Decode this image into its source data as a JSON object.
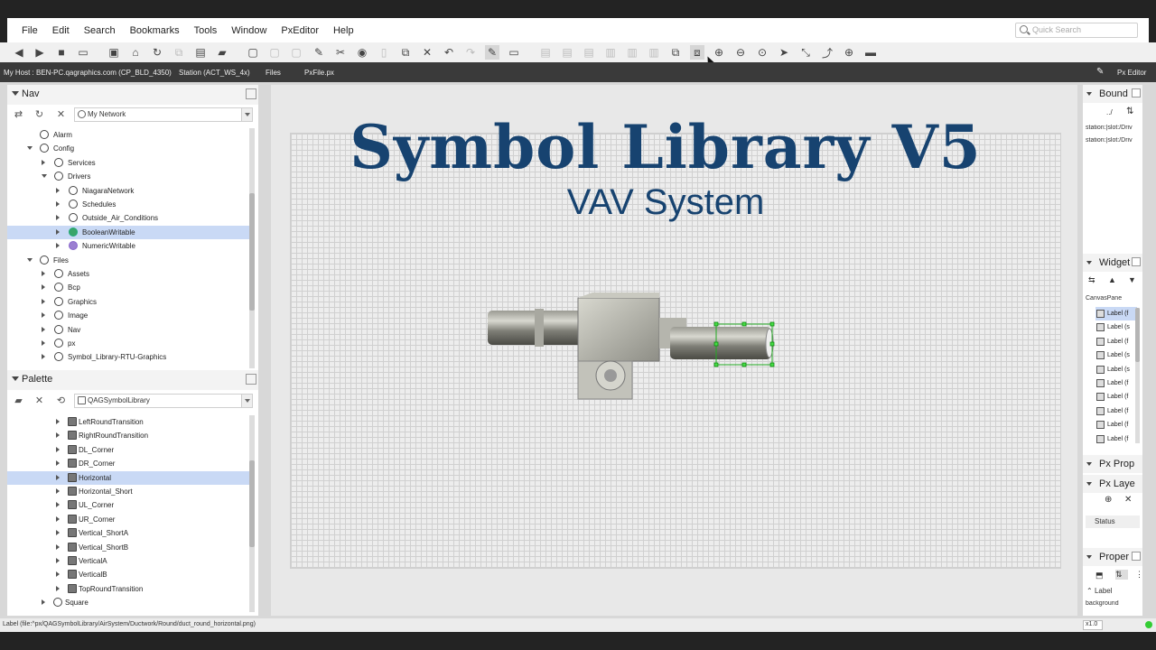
{
  "menubar": {
    "items": [
      "File",
      "Edit",
      "Search",
      "Bookmarks",
      "Tools",
      "Window",
      "PxEditor",
      "Help"
    ],
    "quick_search_placeholder": "Quick Search"
  },
  "locationbar": {
    "crumbs": [
      "My Host : BEN-PC.qagraphics.com (CP_BLD_4350)",
      "Station (ACT_WS_4x)",
      "Files",
      "PxFile.px"
    ],
    "right_label": "Px Editor"
  },
  "nav": {
    "title": "Nav",
    "dropdown": "My Network",
    "tree": [
      {
        "label": "Alarm",
        "indent": 0,
        "expander": "none",
        "icon": "alarm-icon"
      },
      {
        "label": "Config",
        "indent": 0,
        "expander": "open",
        "icon": "config-icon"
      },
      {
        "label": "Services",
        "indent": 1,
        "expander": "closed",
        "icon": "services-icon"
      },
      {
        "label": "Drivers",
        "indent": 1,
        "expander": "open",
        "icon": "drivers-icon"
      },
      {
        "label": "NiagaraNetwork",
        "indent": 2,
        "expander": "closed",
        "icon": "network-icon"
      },
      {
        "label": "Schedules",
        "indent": 2,
        "expander": "closed",
        "icon": "schedule-icon"
      },
      {
        "label": "Outside_Air_Conditions",
        "indent": 2,
        "expander": "closed",
        "icon": "folder-icon"
      },
      {
        "label": "BooleanWritable",
        "indent": 2,
        "expander": "closed",
        "icon": "boolean-icon",
        "selected": true
      },
      {
        "label": "NumericWritable",
        "indent": 2,
        "expander": "closed",
        "icon": "numeric-icon"
      },
      {
        "label": "Files",
        "indent": 0,
        "expander": "open",
        "icon": "files-icon"
      },
      {
        "label": "Assets",
        "indent": 1,
        "expander": "closed",
        "icon": "folder-icon"
      },
      {
        "label": "Bcp",
        "indent": 1,
        "expander": "closed",
        "icon": "folder-icon"
      },
      {
        "label": "Graphics",
        "indent": 1,
        "expander": "closed",
        "icon": "folder-icon"
      },
      {
        "label": "Image",
        "indent": 1,
        "expander": "closed",
        "icon": "folder-icon"
      },
      {
        "label": "Nav",
        "indent": 1,
        "expander": "closed",
        "icon": "folder-icon"
      },
      {
        "label": "px",
        "indent": 1,
        "expander": "closed",
        "icon": "folder-icon"
      },
      {
        "label": "Symbol_Library-RTU-Graphics",
        "indent": 1,
        "expander": "closed",
        "icon": "folder-icon"
      }
    ]
  },
  "palette": {
    "title": "Palette",
    "dropdown": "QAGSymbolLibrary",
    "items": [
      {
        "label": "LeftRoundTransition"
      },
      {
        "label": "RightRoundTransition"
      },
      {
        "label": "DL_Corner"
      },
      {
        "label": "DR_Corner"
      },
      {
        "label": "Horizontal",
        "selected": true
      },
      {
        "label": "Horizontal_Short"
      },
      {
        "label": "UL_Corner"
      },
      {
        "label": "UR_Corner"
      },
      {
        "label": "Vertical_ShortA"
      },
      {
        "label": "Vertical_ShortB"
      },
      {
        "label": "VerticalA"
      },
      {
        "label": "VerticalB"
      },
      {
        "label": "TopRoundTransition"
      }
    ],
    "footer_item": "Square"
  },
  "canvas": {
    "title": "Symbol Library V5",
    "subtitle": "VAV System"
  },
  "bound": {
    "title": "Bound",
    "path_label": "../",
    "items": [
      "station:|slot:/Driv",
      "station:|slot:/Driv"
    ]
  },
  "widget": {
    "title": "Widget",
    "root": "CanvasPane",
    "items": [
      "Label (f",
      "Label (s",
      "Label (f",
      "Label (s",
      "Label (s",
      "Label (f",
      "Label (f",
      "Label (f",
      "Label (f",
      "Label (f"
    ]
  },
  "px_prop": {
    "title": "Px Prop"
  },
  "px_layer": {
    "title": "Px Laye",
    "column": "Status"
  },
  "properties": {
    "title": "Proper",
    "item": "Label",
    "row": "background"
  },
  "statusbar": {
    "text": "Label (file:^px/QAGSymbolLibrary/AirSystem/Ductwork/Round/duct_round_horizontal.png)",
    "zoom": "x1.0"
  },
  "colors": {
    "accent_title": "#174370",
    "selection": "#c9d9f5"
  }
}
